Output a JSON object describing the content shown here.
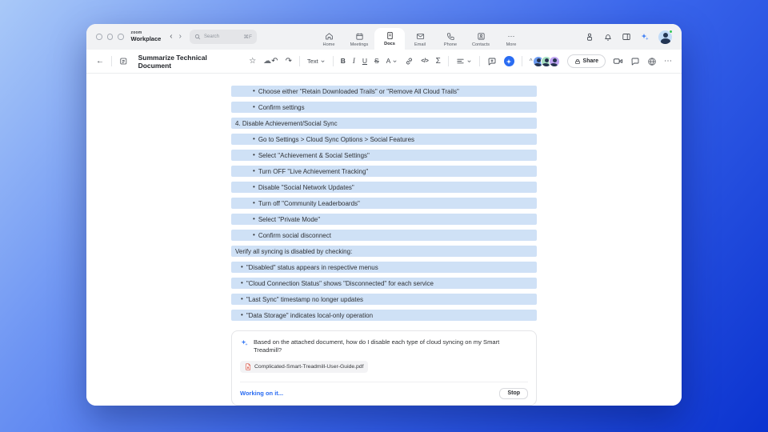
{
  "colors": {
    "accent": "#2a6cf2",
    "highlight": "#cfe1f6",
    "bg_start": "#a9c9f8",
    "bg_mid": "#3a66ec",
    "bg_end": "#0b33cf",
    "status_green": "#35c759"
  },
  "icons": {
    "chevron_left": "‹",
    "chevron_right": "›",
    "back": "←",
    "star": "☆",
    "cloud": "☁",
    "undo": "↶",
    "redo": "↷",
    "more_dots": "⋯",
    "collapse": "^",
    "bullet": "•"
  },
  "window": {
    "brand_top": "zoom",
    "brand_bottom": "Workplace",
    "search": {
      "placeholder": "Search",
      "shortcut": "⌘F"
    },
    "nav": {
      "items": [
        {
          "label": "Home"
        },
        {
          "label": "Meetings"
        },
        {
          "label": "Docs"
        },
        {
          "label": "Email"
        },
        {
          "label": "Phone"
        },
        {
          "label": "Contacts"
        },
        {
          "label": "More"
        }
      ]
    }
  },
  "doc_toolbar": {
    "title": "Summarize Technical Document",
    "text_style_label": "Text",
    "bold": "B",
    "italic": "I",
    "underline": "U",
    "strikethrough": "S",
    "text_color": "A",
    "code": "</>",
    "formula": "Σ",
    "share_label": "Share"
  },
  "document": {
    "rows": [
      {
        "text": "Choose either \"Retain Downloaded Trails\" or \"Remove All Cloud Trails\""
      },
      {
        "text": "Confirm settings"
      },
      {
        "text": "4. Disable Achievement/Social Sync"
      },
      {
        "text": "Go to Settings > Cloud Sync Options > Social Features"
      },
      {
        "text": "Select \"Achievement & Social Settings\""
      },
      {
        "text": "Turn OFF \"Live Achievement Tracking\""
      },
      {
        "text": "Disable \"Social Network Updates\""
      },
      {
        "text": "Turn off \"Community Leaderboards\""
      },
      {
        "text": "Select \"Private Mode\""
      },
      {
        "text": "Confirm social disconnect"
      },
      {
        "text": "Verify all syncing is disabled by checking:"
      },
      {
        "text": "\"Disabled\" status appears in respective menus"
      },
      {
        "text": "\"Cloud Connection Status\" shows \"Disconnected\" for each service"
      },
      {
        "text": "\"Last Sync\" timestamp no longer updates"
      },
      {
        "text": "\"Data Storage\" indicates local-only operation"
      }
    ]
  },
  "ai_panel": {
    "prompt": "Based on the attached document, how do I disable each type of cloud syncing on my Smart Treadmill?",
    "attachment": "Complicated-Smart-Treadmill-User-Guide.pdf",
    "status": "Working on it...",
    "stop_label": "Stop"
  }
}
